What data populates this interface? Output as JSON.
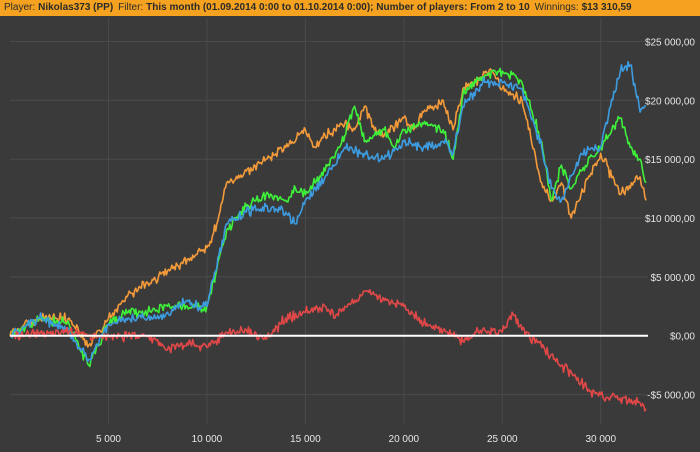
{
  "header": {
    "player_label": "Player:",
    "player_value": "Nikolas373 (PP)",
    "filter_label": "Filter:",
    "filter_value": "This month (01.09.2014 0:00 to 01.10.2014 0:00); Number of players: From 2 to 10",
    "winnings_label": "Winnings:",
    "winnings_value": "$13 310,59"
  },
  "chart_data": {
    "type": "line",
    "xlim": [
      0,
      32400
    ],
    "ylim": [
      -7500,
      27000
    ],
    "x_ticks": [
      5000,
      10000,
      15000,
      20000,
      25000,
      30000
    ],
    "x_tick_labels": [
      "5 000",
      "10 000",
      "15 000",
      "20 000",
      "25 000",
      "30 000"
    ],
    "y_ticks": [
      -5000,
      0,
      5000,
      10000,
      15000,
      20000,
      25000
    ],
    "y_tick_labels": [
      "-$5 000,00",
      "$0,00",
      "$5 000,00",
      "$10 000,00",
      "$15 000,00",
      "$20 000,00",
      "$25 000,00"
    ],
    "y_axis_side": "right",
    "grid": true,
    "zero_line": true,
    "colors": {
      "background": "#3a3a3a",
      "grid": "#4a4a4a",
      "zero_line": "#ffffff",
      "header": "#f4a21f",
      "blue": "#3d9be0",
      "orange": "#f39a3a",
      "green": "#3ff03a",
      "red": "#e04848"
    },
    "series": [
      {
        "color_key": "orange",
        "x": [
          0,
          1500,
          3000,
          3500,
          4000,
          5000,
          6000,
          7000,
          8000,
          9000,
          10000,
          10500,
          11000,
          12000,
          13000,
          14000,
          15000,
          15500,
          16000,
          17000,
          17500,
          18000,
          18500,
          19000,
          20000,
          20500,
          21000,
          22000,
          22500,
          23000,
          24000,
          24500,
          25000,
          26000,
          27000,
          27500,
          28000,
          28500,
          29000,
          30000,
          31000,
          32000,
          32300
        ],
        "y": [
          0,
          1500,
          1500,
          300,
          -800,
          1500,
          3500,
          4500,
          5500,
          6500,
          7500,
          9500,
          13000,
          14000,
          15000,
          16000,
          17500,
          16000,
          17000,
          18000,
          17500,
          19500,
          17500,
          17000,
          18500,
          17500,
          19000,
          20000,
          17500,
          21000,
          22000,
          22500,
          21000,
          20000,
          13000,
          11500,
          13000,
          10000,
          12000,
          15500,
          12000,
          13500,
          11500
        ]
      },
      {
        "color_key": "green",
        "x": [
          0,
          1500,
          3000,
          3500,
          4000,
          5000,
          6000,
          7000,
          8000,
          9000,
          9500,
          10000,
          11000,
          12000,
          13000,
          14000,
          14500,
          15000,
          16000,
          17000,
          17500,
          18000,
          19000,
          19500,
          20000,
          21000,
          22000,
          22500,
          23000,
          24000,
          25000,
          26000,
          27000,
          27500,
          28000,
          28500,
          29000,
          30000,
          31000,
          31500,
          32000,
          32300
        ],
        "y": [
          0,
          1500,
          1000,
          -1000,
          -2500,
          1000,
          2000,
          2000,
          2500,
          2500,
          2500,
          2500,
          9000,
          11000,
          12000,
          11500,
          12500,
          12000,
          14000,
          17000,
          19500,
          16500,
          17500,
          16000,
          17500,
          18000,
          17500,
          15000,
          20500,
          22000,
          22500,
          21500,
          16500,
          11500,
          14500,
          12500,
          14000,
          16000,
          18500,
          16000,
          15000,
          13000
        ]
      },
      {
        "color_key": "blue",
        "x": [
          0,
          1500,
          3000,
          3500,
          4000,
          5000,
          6000,
          7000,
          8000,
          9000,
          9500,
          10000,
          11000,
          12000,
          13000,
          14000,
          14500,
          15000,
          16000,
          17000,
          18000,
          19000,
          20000,
          21000,
          22000,
          22500,
          23000,
          24000,
          25000,
          26000,
          27000,
          27500,
          28000,
          29000,
          30000,
          30500,
          31000,
          31500,
          32000,
          32300
        ],
        "y": [
          0,
          1500,
          500,
          -1000,
          -2000,
          1000,
          1500,
          1500,
          2000,
          3000,
          2500,
          2500,
          9500,
          10500,
          11000,
          10500,
          9500,
          11500,
          13500,
          16000,
          15500,
          15000,
          16500,
          16000,
          16500,
          15500,
          19500,
          21500,
          21500,
          21000,
          16000,
          12500,
          11500,
          15500,
          16000,
          19500,
          22500,
          23000,
          19000,
          19500
        ]
      },
      {
        "color_key": "red",
        "x": [
          0,
          2000,
          3000,
          4000,
          5000,
          6000,
          7000,
          8000,
          9000,
          10000,
          11000,
          12000,
          13000,
          14000,
          15000,
          16000,
          16500,
          17000,
          17500,
          18000,
          18500,
          19000,
          20000,
          21000,
          22000,
          23000,
          24000,
          25000,
          25500,
          26000,
          27000,
          28000,
          29000,
          29500,
          30000,
          31000,
          32000,
          32300
        ],
        "y": [
          0,
          200,
          300,
          0,
          0,
          0,
          0,
          -1200,
          -600,
          -1000,
          300,
          500,
          -300,
          1500,
          2000,
          2500,
          1500,
          2500,
          3000,
          3800,
          3500,
          3000,
          2500,
          1000,
          500,
          -500,
          500,
          300,
          2000,
          500,
          -1000,
          -2500,
          -4000,
          -4700,
          -5000,
          -5300,
          -5700,
          -6200
        ]
      }
    ]
  }
}
